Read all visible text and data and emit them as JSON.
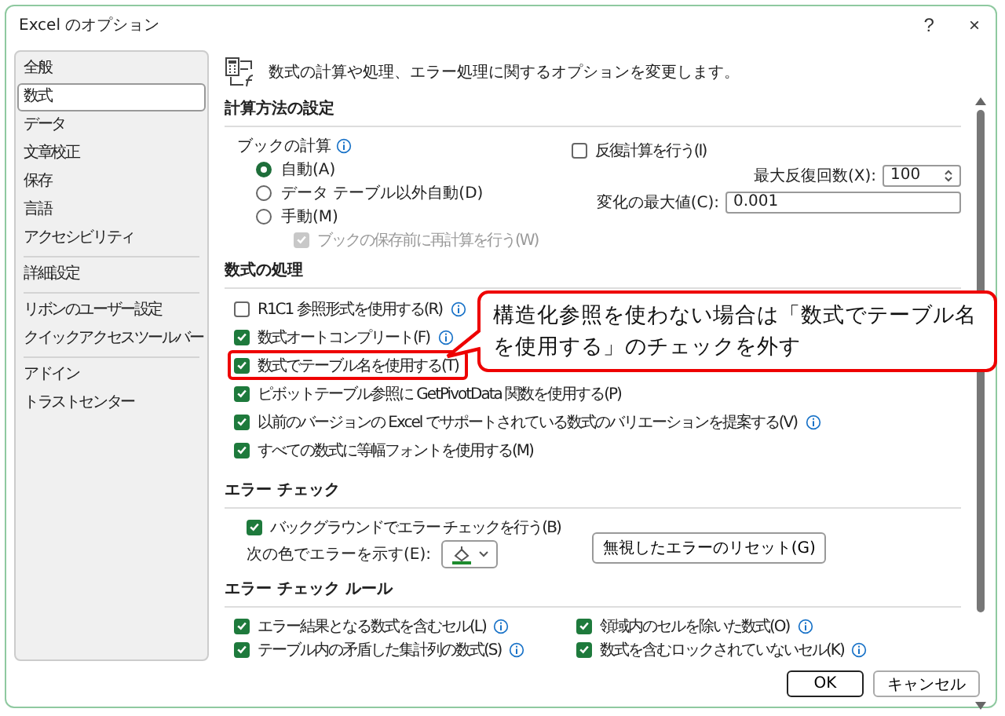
{
  "window": {
    "title": "Excel のオプション",
    "help": "?",
    "close": "×"
  },
  "sidebar": {
    "groups": [
      [
        {
          "label": "全般",
          "selected": false
        },
        {
          "label": "数式",
          "selected": true
        },
        {
          "label": "データ",
          "selected": false
        },
        {
          "label": "文章校正",
          "selected": false
        },
        {
          "label": "保存",
          "selected": false
        },
        {
          "label": "言語",
          "selected": false
        },
        {
          "label": "アクセシビリティ",
          "selected": false
        }
      ],
      [
        {
          "label": "詳細設定",
          "selected": false
        }
      ],
      [
        {
          "label": "リボンのユーザー設定",
          "selected": false
        },
        {
          "label": "クイック アクセス ツール バー",
          "selected": false
        }
      ],
      [
        {
          "label": "アドイン",
          "selected": false
        },
        {
          "label": "トラスト センター",
          "selected": false
        }
      ]
    ]
  },
  "header": "数式の計算や処理、エラー処理に関するオプションを変更します。",
  "calculation": {
    "title": "計算方法の設定",
    "workbook_label": "ブックの計算",
    "workbook_info": true,
    "radios": [
      {
        "label": "自動(A)",
        "selected": true
      },
      {
        "label": "データ テーブル以外自動(D)",
        "selected": false
      },
      {
        "label": "手動(M)",
        "selected": false
      }
    ],
    "recalc_before_save": {
      "label": "ブックの保存前に再計算を行う(W)",
      "checked": true,
      "disabled": true
    },
    "iterative": {
      "label": "反復計算を行う(I)",
      "checked": false
    },
    "fields": [
      {
        "label": "最大反復回数(X):",
        "value": "100",
        "kind": "spin"
      },
      {
        "label": "変化の最大値(C):",
        "value": "0.001",
        "kind": "text"
      }
    ]
  },
  "formulas": {
    "title": "数式の処理",
    "items": [
      {
        "label": "R1C1 参照形式を使用する(R)",
        "checked": false,
        "info": true,
        "highlighted": false
      },
      {
        "label": "数式オートコンプリート(F)",
        "checked": true,
        "info": true,
        "highlighted": false
      },
      {
        "label": "数式でテーブル名を使用する(T)",
        "checked": true,
        "info": false,
        "highlighted": true
      },
      {
        "label": "ピボットテーブル参照に GetPivotData 関数を使用する(P)",
        "checked": true,
        "info": false,
        "highlighted": false
      },
      {
        "label": "以前のバージョンの Excel でサポートされている数式のバリエーションを提案する(V)",
        "checked": true,
        "info": true,
        "highlighted": false
      },
      {
        "label": "すべての数式に等幅フォントを使用する(M)",
        "checked": true,
        "info": false,
        "highlighted": false
      }
    ]
  },
  "error_checking": {
    "title": "エラー チェック",
    "background": {
      "label": "バックグラウンドでエラー チェックを行う(B)",
      "checked": true
    },
    "color_label": "次の色でエラーを示す(E):",
    "reset_button": "無視したエラーのリセット(G)"
  },
  "rules": {
    "title": "エラー チェック ルール",
    "columns": [
      [
        {
          "label": "エラー結果となる数式を含むセル(L)",
          "checked": true,
          "info": true
        },
        {
          "label": "テーブル内の矛盾した集計列の数式(S)",
          "checked": true,
          "info": true
        }
      ],
      [
        {
          "label": "領域内のセルを除いた数式(O)",
          "checked": true,
          "info": true
        },
        {
          "label": "数式を含むロックされていないセル(K)",
          "checked": true,
          "info": true
        }
      ]
    ]
  },
  "callout": {
    "text": "構造化参照を使わない場合は「数式でテーブル名を使用する」のチェックを外す"
  },
  "buttons": [
    {
      "label": "OK",
      "kind": "default"
    },
    {
      "label": "キャンセル",
      "kind": "normal"
    }
  ]
}
